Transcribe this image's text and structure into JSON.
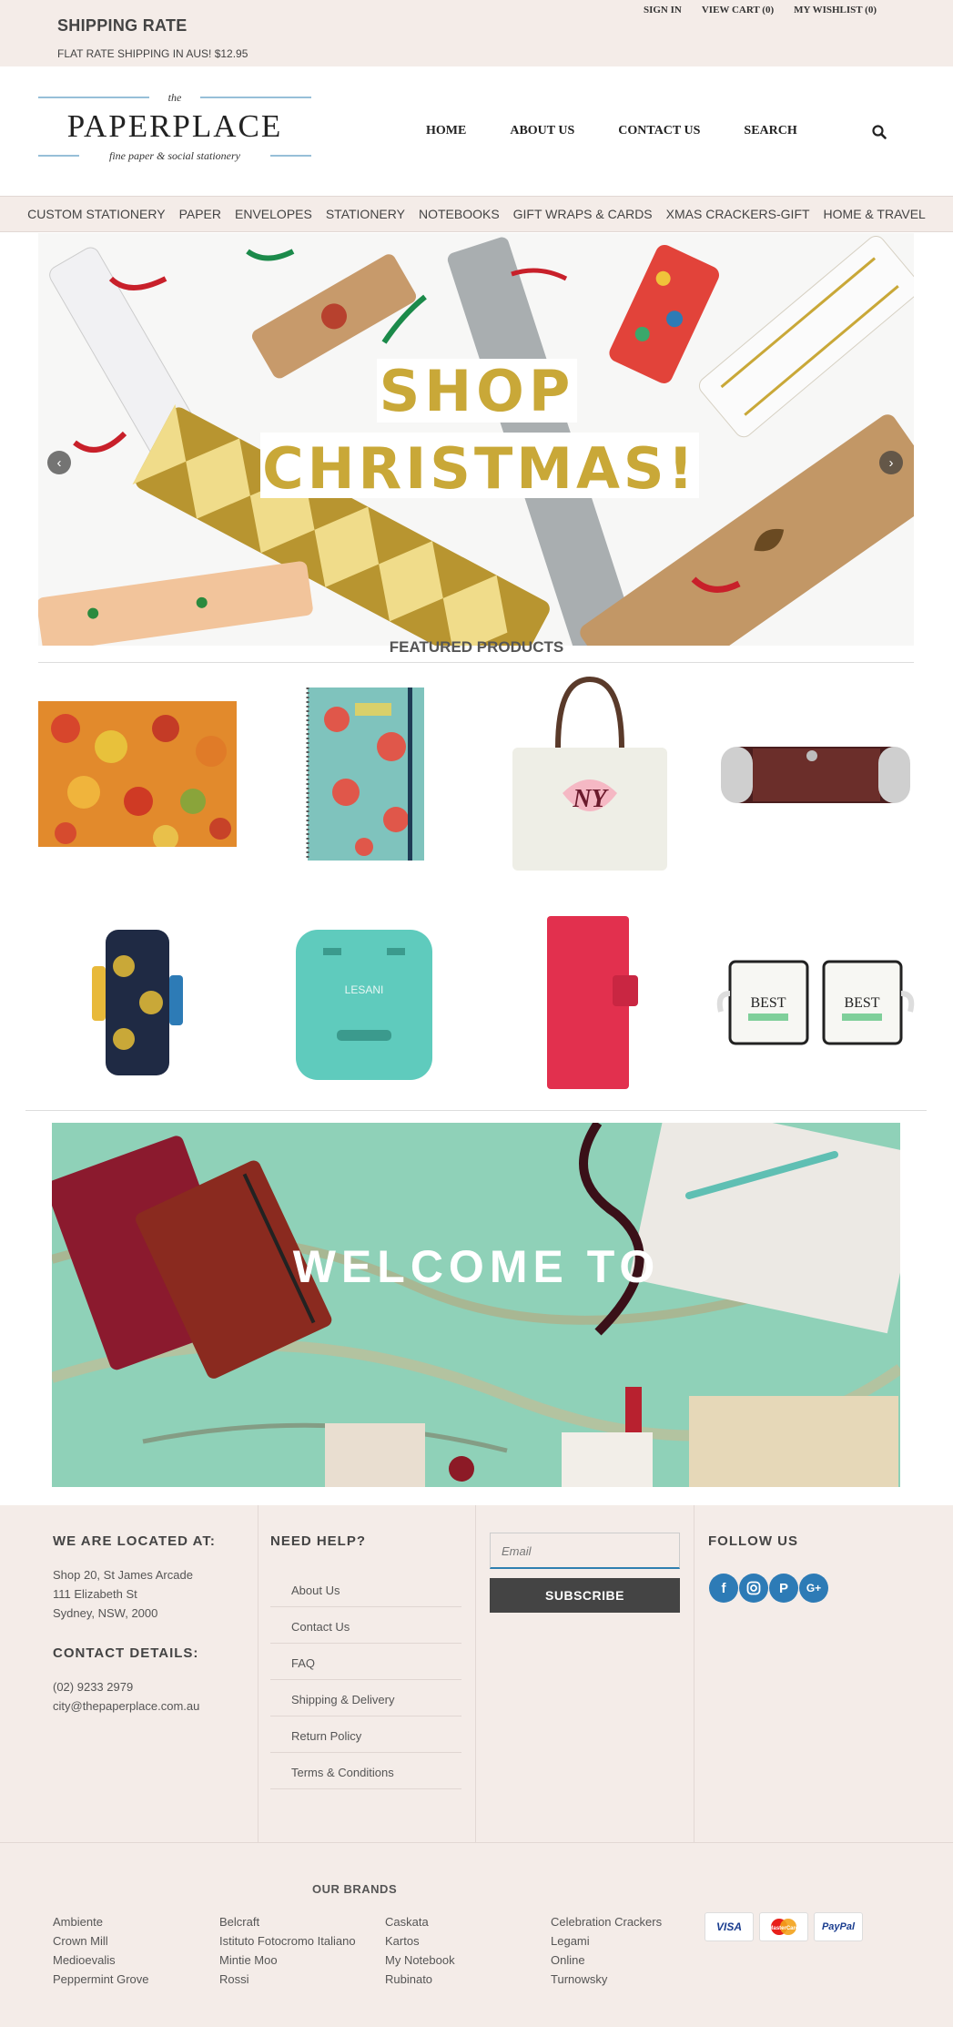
{
  "topbar": {
    "shipping_title": "SHIPPING RATE",
    "shipping_text": "FLAT RATE SHIPPING IN AUS! $12.95",
    "links": [
      "SIGN IN",
      "VIEW CART (0)",
      "MY WISHLIST (0)"
    ]
  },
  "logo": {
    "the": "the",
    "name": "PAPERPLACE",
    "tagline": "fine paper & social stationery"
  },
  "mainnav": [
    "HOME",
    "ABOUT US",
    "CONTACT US",
    "SEARCH"
  ],
  "catnav": [
    "CUSTOM STATIONERY",
    "PAPER",
    "ENVELOPES",
    "STATIONERY",
    "NOTEBOOKS",
    "GIFT WRAPS & CARDS",
    "XMAS CRACKERS-GIFT",
    "HOME & TRAVEL"
  ],
  "hero": {
    "line1": "SHOP",
    "line2": "CHRISTMAS!"
  },
  "featured": {
    "title": "FEATURED PRODUCTS"
  },
  "welcome": {
    "text": "WELCOME TO"
  },
  "footer": {
    "location_heading": "WE ARE LOCATED AT:",
    "address": [
      "Shop 20, St James Arcade",
      "111 Elizabeth St",
      "Sydney, NSW, 2000"
    ],
    "contact_heading": "CONTACT DETAILS:",
    "phone": "(02) 9233 2979",
    "email": "city@thepaperplace.com.au",
    "help_heading": "NEED HELP?",
    "help_links": [
      "About Us",
      "Contact Us",
      "FAQ",
      "Shipping & Delivery",
      "Return Policy",
      "Terms & Conditions"
    ],
    "email_placeholder": "Email",
    "subscribe_label": "SUBSCRIBE",
    "follow_heading": "FOLLOW US",
    "social_icons": [
      "facebook-icon",
      "instagram-icon",
      "pinterest-icon",
      "google-plus-icon"
    ]
  },
  "brands": {
    "title": "OUR BRANDS",
    "col1": [
      "Ambiente",
      "Crown Mill",
      "Medioevalis",
      "Peppermint Grove"
    ],
    "col2": [
      "Belcraft",
      "Istituto Fotocromo Italiano",
      "Mintie Moo",
      "Rossi"
    ],
    "col3": [
      "Caskata",
      "Kartos",
      "My Notebook",
      "Rubinato"
    ],
    "col4": [
      "Celebration Crackers",
      "Legami",
      "Online",
      "Turnowsky"
    ],
    "payments": [
      "VISA",
      "MasterCard",
      "PayPal"
    ]
  },
  "colors": {
    "topbar_bg": "#f4ece8",
    "social_blue": "#2d7bb6",
    "accent_gold": "#c9a838"
  }
}
